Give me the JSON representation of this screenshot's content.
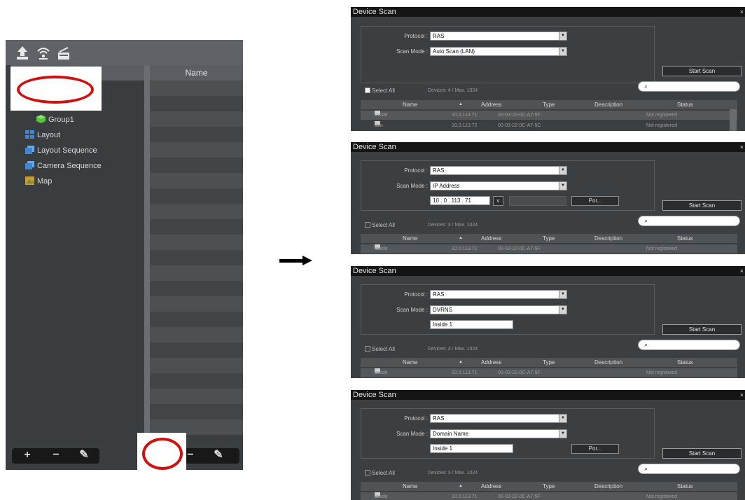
{
  "left_panel": {
    "toolbar_icons": [
      "upload-icon",
      "wifi-icon",
      "scanner-icon"
    ],
    "name_column_header": "Name",
    "tree_items": [
      {
        "label": "Group1",
        "icon": "cube-icon",
        "color": "#56c43c"
      },
      {
        "label": "Layout",
        "icon": "layout-icon",
        "color": "#3f86d6"
      },
      {
        "label": "Layout Sequence",
        "icon": "layout-sequence-icon",
        "color": "#3f86d6"
      },
      {
        "label": "Camera Sequence",
        "icon": "camera-sequence-icon",
        "color": "#3f86d6"
      },
      {
        "label": "Map",
        "icon": "map-icon",
        "color": "#c89a3a"
      }
    ],
    "bottom_buttons": [
      "+",
      "−",
      "✎",
      "−",
      "✎"
    ]
  },
  "highlight_color": "#d01010",
  "panels": [
    {
      "title": "Device Scan",
      "close": "×",
      "protocol_label": "Protocol :",
      "protocol_value": "RAS",
      "scan_mode_label": "Scan Mode :",
      "scan_mode_value": "Auto Scan (LAN)",
      "start_scan": "Start Scan",
      "search_glyph": "⌕",
      "select_all": "Select All",
      "devices": "Devices: 4 / Max. 1024",
      "columns": [
        "Name",
        "▲",
        "Address",
        "Type",
        "Description",
        "Status"
      ],
      "rows": [
        {
          "checked": "☑",
          "name": "Inside 1",
          "address": "10.0.113.71",
          "type": "00-03-22-0C-A7-5F",
          "status": "Not registered"
        },
        {
          "checked": "☐",
          "name": "Info. Desk",
          "address": "10.0.113.72",
          "type": "00-03-22-0C-A7-5C",
          "status": "Not registered"
        }
      ]
    },
    {
      "title": "Device Scan",
      "close": "×",
      "protocol_label": "Protocol :",
      "protocol_value": "RAS",
      "scan_mode_label": "Scan Mode :",
      "scan_mode_value": "IP Address",
      "ip_value": "10 . 0 . 113 . 71",
      "ip_toggle": "v",
      "port_button": "Por...",
      "start_scan": "Start Scan",
      "search_glyph": "⌕",
      "select_all": "Select All",
      "devices": "Devices: 3 / Max. 1024",
      "columns": [
        "Name",
        "▲",
        "Address",
        "Type",
        "Description",
        "Status"
      ],
      "rows": [
        {
          "checked": "☑",
          "name": "Inside 1",
          "address": "10.0.113.71",
          "type": "00-03-22-0C-A7-5F",
          "status": "Not registered"
        }
      ]
    },
    {
      "title": "Device Scan",
      "close": "×",
      "protocol_label": "Protocol :",
      "protocol_value": "RAS",
      "scan_mode_label": "Scan Mode :",
      "scan_mode_value": "DVRNS",
      "text_value": "Inside 1",
      "start_scan": "Start Scan",
      "search_glyph": "⌕",
      "select_all": "Select All",
      "devices": "Devices: 3 / Max. 1024",
      "columns": [
        "Name",
        "▲",
        "Address",
        "Type",
        "Description",
        "Status"
      ],
      "rows": [
        {
          "checked": "☑",
          "name": "Inside 1",
          "address": "10.0.113.71",
          "type": "00-03-22-0C-A7-5F",
          "status": "Not registered"
        }
      ]
    },
    {
      "title": "Device Scan",
      "close": "×",
      "protocol_label": "Protocol :",
      "protocol_value": "RAS",
      "scan_mode_label": "Scan Mode :",
      "scan_mode_value": "Domain Name",
      "text_value": "Inside 1",
      "port_button": "Por...",
      "start_scan": "Start Scan",
      "search_glyph": "⌕",
      "select_all": "Select All",
      "devices": "Devices: 3 / Max. 1024",
      "columns": [
        "Name",
        "▲",
        "Address",
        "Type",
        "Description",
        "Status"
      ],
      "rows": [
        {
          "checked": "☑",
          "name": "Inside 1",
          "address": "10.0.113.71",
          "type": "00-03-22-0C-A7-5F",
          "status": "Not registered"
        }
      ]
    }
  ]
}
